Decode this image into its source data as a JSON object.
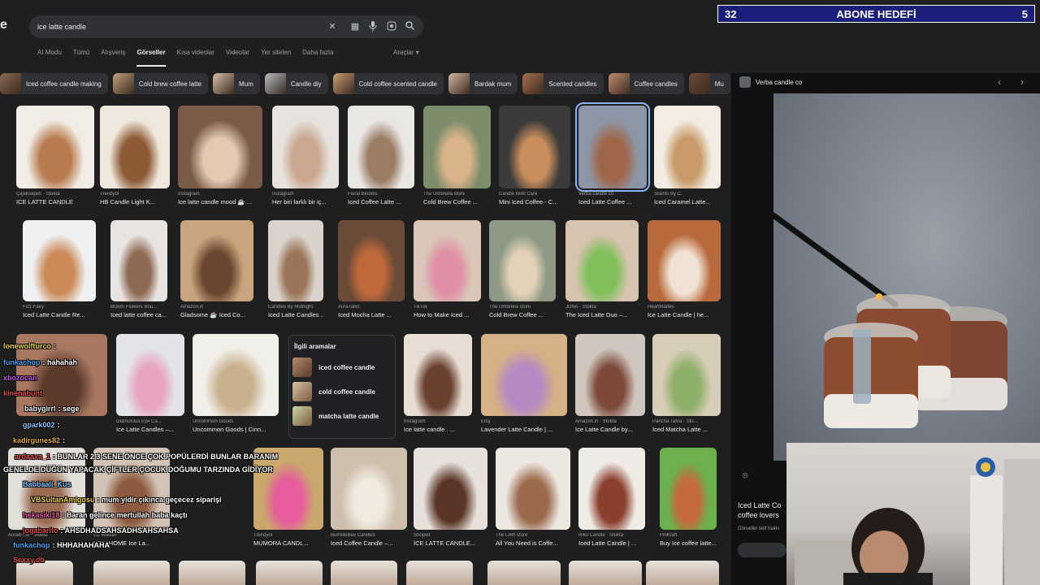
{
  "search": {
    "query": "ice latte candle",
    "logo_fragment": "e"
  },
  "goal_overlay": {
    "left_count": "32",
    "title": "ABONE HEDEFİ",
    "right_count": "5"
  },
  "tabs": [
    {
      "label": "AI Modu",
      "active": false
    },
    {
      "label": "Tümü",
      "active": false
    },
    {
      "label": "Alışveriş",
      "active": false
    },
    {
      "label": "Görseller",
      "active": true
    },
    {
      "label": "Kısa videolar",
      "active": false
    },
    {
      "label": "Videolar",
      "active": false
    },
    {
      "label": "Yer siteleri",
      "active": false
    },
    {
      "label": "Daha fazla",
      "active": false
    }
  ],
  "tools_label": "Araçlar",
  "chips": [
    {
      "label": "Iced coffee candle making",
      "color": "#8a6a55"
    },
    {
      "label": "Cold brew coffee latte",
      "color": "#c2a27c"
    },
    {
      "label": "Mum",
      "color": "#d8c0a8"
    },
    {
      "label": "Candle diy",
      "color": "#b6bcc2"
    },
    {
      "label": "Cold coffee scented candle",
      "color": "#c9a074"
    },
    {
      "label": "Bardak mum",
      "color": "#d4b5a0"
    },
    {
      "label": "Scented candles",
      "color": "#a5704d"
    },
    {
      "label": "Coffee candles",
      "color": "#c48d6f"
    },
    {
      "label": "Mu",
      "color": "#6b4a36"
    }
  ],
  "grid": [
    {
      "src": "Çiçeksepeti · Stokta",
      "cap": "ICE LATTE CANDLE",
      "c1": "#f1ede6",
      "c2": "#b87a4e"
    },
    {
      "src": "Trendyol",
      "cap": "HB Candle Light K...",
      "c1": "#efe8dc",
      "c2": "#8c5a35"
    },
    {
      "src": "Instagram",
      "cap": "Ice latte candle mood ☕ ...",
      "c1": "#7a5a48",
      "c2": "#e2cbb2"
    },
    {
      "src": "Instagram",
      "cap": "Her biri farklı bir iç...",
      "c1": "#e6e2de",
      "c2": "#c9a88f"
    },
    {
      "src": "Floral Blooms",
      "cap": "Iced Coffee Latte ...",
      "c1": "#e9e7e4",
      "c2": "#9c7c63"
    },
    {
      "src": "The Umbrella store",
      "cap": "Cold Brew Coffee ...",
      "c1": "#7d8c6a",
      "c2": "#d9b48a"
    },
    {
      "src": "Candle With Care",
      "cap": "Mini Iced Coffee - C...",
      "c1": "#3b3b3b",
      "c2": "#c98e5c"
    },
    {
      "src": "Verba candle co",
      "cap": "Iced Latte Coffee ...",
      "c1": "#8d96a6",
      "c2": "#a0664a",
      "selected": true
    },
    {
      "src": "Scents By C.",
      "cap": "Iced Caramel Latte...",
      "c1": "#f2ece2",
      "c2": "#c99b6a"
    },
    {
      "src": "Fizz Fairy",
      "cap": "Iced Latte Candle Re...",
      "c1": "#eef0f2",
      "c2": "#cc8a59"
    },
    {
      "src": "Bloom Flowers Bou...",
      "cap": "Iced latte coffee ca...",
      "c1": "#e7e4e1",
      "c2": "#8e6a54"
    },
    {
      "src": "Amazon.in",
      "cap": "Gladsome ☕ Iced Co...",
      "c1": "#c8a57e",
      "c2": "#6a4530"
    },
    {
      "src": "Candles By Midnight",
      "cap": "Iced Latte Candles ...",
      "c1": "#d9d3cb",
      "c2": "#9b7459"
    },
    {
      "src": "AuraTales",
      "cap": "Iced Mocha Latte ...",
      "c1": "#6a4a38",
      "c2": "#c06a3a"
    },
    {
      "src": "TikTok",
      "cap": "How to Make Iced ...",
      "c1": "#d9c6b8",
      "c2": "#e08fa6"
    },
    {
      "src": "The Umbrella store",
      "cap": "Cold Brew Coffee ...",
      "c1": "#8e9a86",
      "c2": "#e4d2b8"
    },
    {
      "src": "JUNA · Stokta",
      "cap": "The Iced Latte Duo –...",
      "c1": "#d6c3b0",
      "c2": "#7fc05a"
    },
    {
      "src": "HeartMades",
      "cap": "Ice Latte Candle | he...",
      "c1": "#b86a3c",
      "c2": "#f0e3d5"
    },
    {
      "src": "",
      "cap": "",
      "c1": "#a77760",
      "c2": "#5b3a2c"
    },
    {
      "src": "Glamorous Eye Ca...",
      "cap": "Ice Latte Candles –...",
      "c1": "#e3e3e8",
      "c2": "#e9a4c0"
    },
    {
      "src": "Uncommon Goods",
      "cap": "Uncommon Goods | Cinn...",
      "c1": "#f1efe9",
      "c2": "#c9b08e"
    },
    {
      "src": "Instagram",
      "cap": "Ice latte candle . ...",
      "c1": "#e7ddd3",
      "c2": "#6a4131"
    },
    {
      "src": "Etsy",
      "cap": "Lavender Latte Candle | ...",
      "c1": "#d6b186",
      "c2": "#b48ac4"
    },
    {
      "src": "Amazon.in · Stokta",
      "cap": "Ice Latte Candle by...",
      "c1": "#cfc7bf",
      "c2": "#7d4a3a"
    },
    {
      "src": "Pancha Tatva · Sto...",
      "cap": "Iced Matcha Latte ...",
      "c1": "#d8cdb8",
      "c2": "#8fb06a"
    },
    {
      "src": "Auramma · Stokta",
      "cap": "",
      "c1": "#e2dfdb",
      "c2": "#9a6d52"
    },
    {
      "src": "LC Waikiki",
      "cap": "LCW HOME Ice La...",
      "c1": "#d2c3b6",
      "c2": "#8c5b3f"
    },
    {
      "src": "Trendyol",
      "cap": "MUMORA CANDL...",
      "c1": "#c9a76d",
      "c2": "#e65c9c"
    },
    {
      "src": "BumbleBee Candles",
      "cap": "Iced Coffee Candle –...",
      "c1": "#cfc0ae",
      "c2": "#f1eadf"
    },
    {
      "src": "Shopier",
      "cap": "İCE LATTE CANDLE...",
      "c1": "#e6e1db",
      "c2": "#5a3527"
    },
    {
      "src": "The Lilith store",
      "cap": "All You Need is Coffe...",
      "c1": "#ece7e1",
      "c2": "#9b6a4c"
    },
    {
      "src": "Riko Candle · Stokta",
      "cap": "Iced Latte Candle | ...",
      "c1": "#efece8",
      "c2": "#8a3f2e"
    },
    {
      "src": "PinKraft",
      "cap": "Buy Ice coffee latte...",
      "c1": "#6db04e",
      "c2": "#c46a3c"
    }
  ],
  "related": {
    "title": "İlgili aramalar",
    "items": [
      "iced coffee candle",
      "cold coffee candle",
      "matcha latte candle"
    ]
  },
  "preview": {
    "site": "Verba candle co",
    "title": "Iced Latte Co coffee lovers",
    "subtitle": "Görseller telif hakkı"
  },
  "chat": [
    {
      "user": "lonewolfturco",
      "text": ":",
      "color": "#e8d24a"
    },
    {
      "user": "funkachop",
      "text": ": hahahah",
      "color": "#4aa3f5"
    },
    {
      "user": "xbozocan",
      "text": "",
      "color": "#c05ae0"
    },
    {
      "user": "kinenabunt",
      "text": "",
      "color": "#e04a4a"
    },
    {
      "user": "babygirrl",
      "text": ": sege",
      "color": "#f0f0f0"
    },
    {
      "user": "gpark002",
      "text": ":",
      "color": "#8ec5ff"
    },
    {
      "user": "kadirgunes82",
      "text": ":",
      "color": "#e0a94a"
    },
    {
      "user": "ardaaxa_1",
      "text": ": BUNLAR 2 3 SENE ÖNCE ÇOK POPÜLERDİ BUNLAR BARANIM",
      "color": "#e04a4a"
    },
    {
      "user": "",
      "text": "GENELDE DÜĞÜN YAPACAK ÇİFTLER ÇOCUK DOĞUMU TARZINDA GİDİYOR",
      "color": "#ffffff"
    },
    {
      "user": "Babbaali_Kus",
      "text": "",
      "color": "#7ac7ff"
    },
    {
      "user": "VBSultanAmigosu",
      "text": ": mum yidir çıkınca geçecez siparişi",
      "color": "#f0d24a"
    },
    {
      "user": "hekasiki18",
      "text": ": Baran gelince mertullah baba kaçtı",
      "color": "#e05aa0"
    },
    {
      "user": "jogabarito",
      "text": ": AHSDHADSAHSADHSAHSAHSA",
      "color": "#e04a4a"
    },
    {
      "user": "funkachop",
      "text": ": HHHAHAHAHA",
      "color": "#4aa3f5"
    },
    {
      "user": "Sexxy.db",
      "text": "",
      "color": "#e04a4a"
    }
  ]
}
